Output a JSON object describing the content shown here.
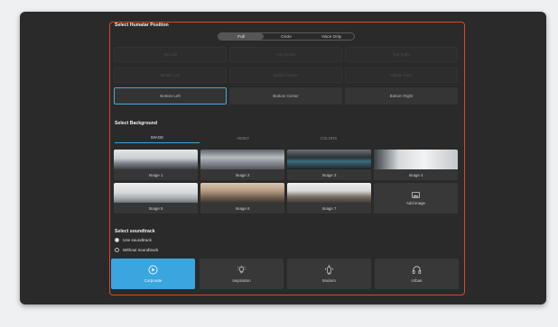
{
  "position_section": {
    "title": "Select Humatar Position",
    "modes": [
      "Full",
      "Circle",
      "Voice Only"
    ],
    "selected_mode": "Full",
    "positions": [
      {
        "label": "Top Left",
        "state": "dim"
      },
      {
        "label": "Top Center",
        "state": "dim"
      },
      {
        "label": "Top Right",
        "state": "dim"
      },
      {
        "label": "Middle Left",
        "state": "dim"
      },
      {
        "label": "Middle Center",
        "state": "dim"
      },
      {
        "label": "Middle Right",
        "state": "dim"
      },
      {
        "label": "Bottom Left",
        "state": "active"
      },
      {
        "label": "Bottom Center",
        "state": "enabled"
      },
      {
        "label": "Bottom Right",
        "state": "enabled"
      }
    ]
  },
  "background_section": {
    "title": "Select Background",
    "tabs": [
      "IMAGE",
      "VIDEO",
      "COLORS"
    ],
    "selected_tab": "IMAGE",
    "images": [
      "Image 1",
      "Image 2",
      "Image 3",
      "Image 4",
      "Image 5",
      "Image 6",
      "Image 7"
    ],
    "add_label": "Add image"
  },
  "soundtrack_section": {
    "title": "Select soundtrack",
    "options": [
      "Use soundtrack",
      "Without soundtrack"
    ],
    "selected_option": "Use soundtrack",
    "tracks": [
      {
        "label": "Corporate",
        "icon": "play-circle-icon",
        "selected": true
      },
      {
        "label": "Inspiration",
        "icon": "lightbulb-icon",
        "selected": false
      },
      {
        "label": "Modern",
        "icon": "modern-icon",
        "selected": false
      },
      {
        "label": "Urban",
        "icon": "headphones-icon",
        "selected": false
      }
    ]
  },
  "colors": {
    "accent": "#3aa6e0",
    "highlight_border": "#e0452c",
    "panel_bg": "#2a2a2a"
  }
}
